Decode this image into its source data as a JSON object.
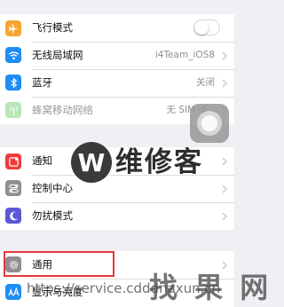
{
  "group1": {
    "airplane": {
      "label": "飞行模式",
      "icon": "airplane-icon",
      "color": "#f7a531"
    },
    "wifi": {
      "label": "无线局域网",
      "value": "i4Team_iOS8",
      "icon": "wifi-icon",
      "color": "#1e8df5"
    },
    "bluetooth": {
      "label": "蓝牙",
      "value": "关闭",
      "icon": "bluetooth-icon",
      "color": "#1e8df5"
    },
    "cellular": {
      "label": "蜂窝移动网络",
      "value": "无 SIM 卡",
      "icon": "antenna-icon",
      "color": "#b9e6b8"
    }
  },
  "group2": {
    "notifications": {
      "label": "通知",
      "icon": "notifications-icon",
      "color": "#ef3b3a"
    },
    "control_center": {
      "label": "控制中心",
      "icon": "control-center-icon",
      "color": "#8e8e93"
    },
    "dnd": {
      "label": "勿扰模式",
      "icon": "moon-icon",
      "color": "#5b57d6"
    }
  },
  "group3": {
    "general": {
      "label": "通用",
      "icon": "gear-icon",
      "color": "#8e8e93"
    },
    "display": {
      "label": "显示与亮度",
      "icon": "text-size-icon",
      "color": "#1e8df5"
    }
  },
  "watermark": {
    "logo_letter": "W",
    "brand": "维修客",
    "url": "https://service.cdddnaxun.cn",
    "big": "找 果 网"
  }
}
